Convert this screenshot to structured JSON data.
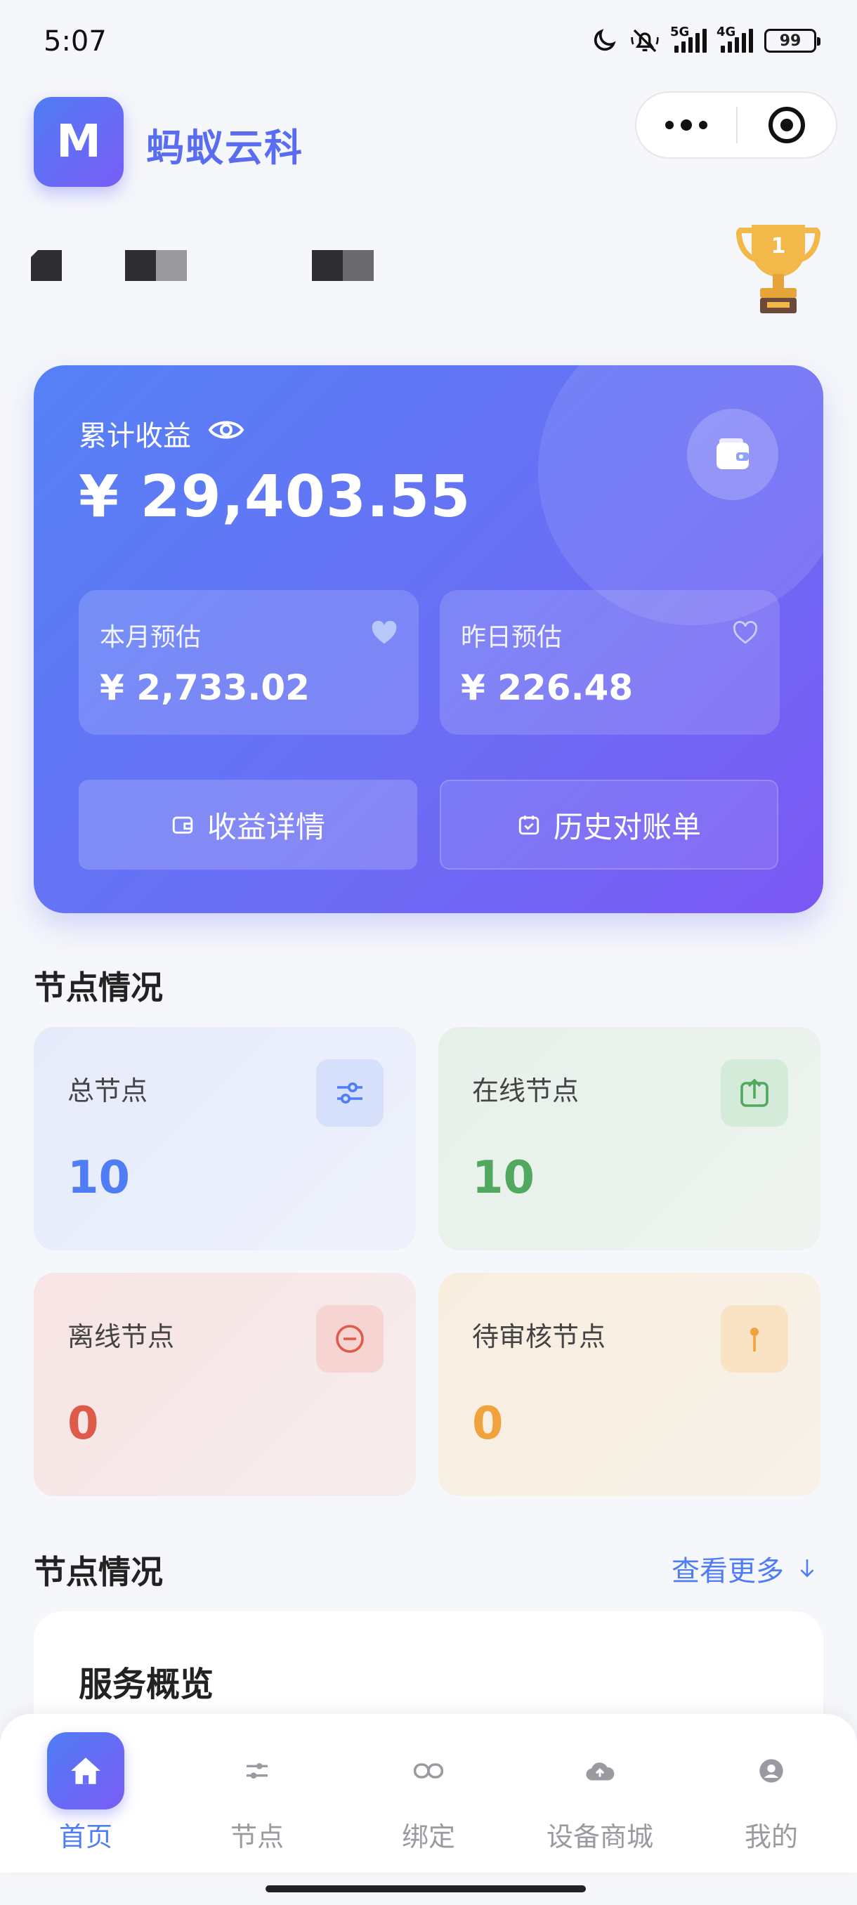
{
  "status_bar": {
    "time": "5:07",
    "net1": "5G",
    "net2": "4G",
    "battery": "99"
  },
  "header": {
    "logo_letter": "M",
    "brand_name": "蚂蚁云科"
  },
  "earnings": {
    "total_label": "累计收益",
    "total_amount": "¥ 29,403.55",
    "month_label": "本月预估",
    "month_amount": "¥ 2,733.02",
    "yesterday_label": "昨日预估",
    "yesterday_amount": "¥ 226.48",
    "detail_button": "收益详情",
    "history_button": "历史对账单"
  },
  "nodes": {
    "section_title": "节点情况",
    "total_label": "总节点",
    "total_value": "10",
    "online_label": "在线节点",
    "online_value": "10",
    "offline_label": "离线节点",
    "offline_value": "0",
    "pending_label": "待审核节点",
    "pending_value": "0"
  },
  "overview": {
    "section_title": "节点情况",
    "see_more": "查看更多",
    "card_title": "服务概览"
  },
  "tabs": [
    {
      "label": "首页",
      "icon": "home-icon",
      "active": true
    },
    {
      "label": "节点",
      "icon": "sliders-icon"
    },
    {
      "label": "绑定",
      "icon": "link-icon"
    },
    {
      "label": "设备商城",
      "icon": "cloud-upload-icon"
    },
    {
      "label": "我的",
      "icon": "user-icon"
    }
  ],
  "colors": {
    "accent": "#4f7df5",
    "accent2": "#7a5cf5",
    "online": "#52a85e",
    "offline": "#e05a4a",
    "pending": "#f0a23c"
  }
}
